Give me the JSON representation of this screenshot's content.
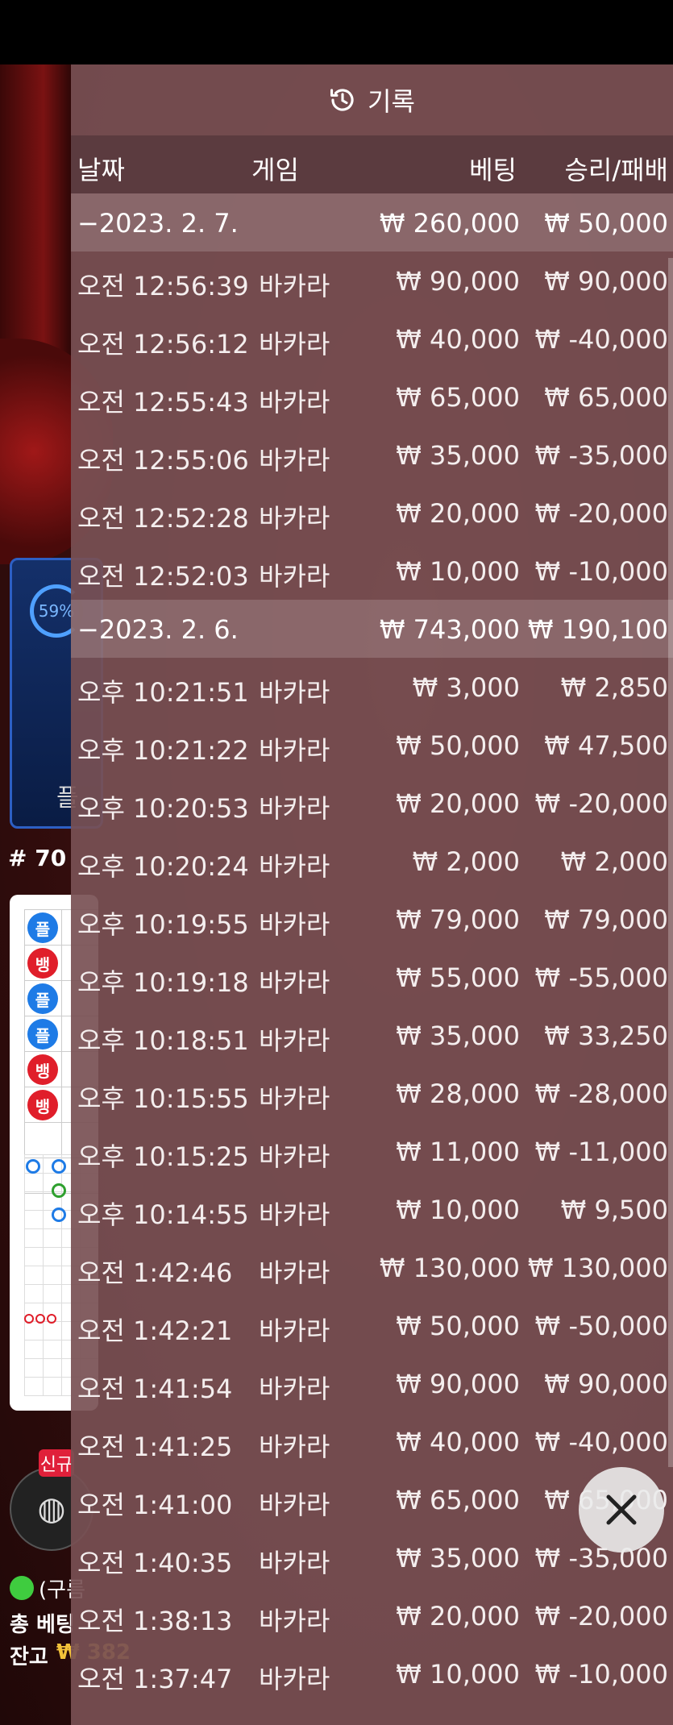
{
  "background": {
    "stat_percent": "59%",
    "stat_label": "플",
    "round_label": "# 70",
    "beads": [
      {
        "label": "플",
        "type": "player"
      },
      {
        "label": "뱅",
        "type": "banker"
      },
      {
        "label": "플",
        "type": "player"
      },
      {
        "label": "플",
        "type": "player"
      },
      {
        "label": "뱅",
        "type": "banker"
      },
      {
        "label": "뱅",
        "type": "banker"
      }
    ],
    "new_badge": "신규",
    "status_text": "(구름",
    "total_bet_label": "총 베팅",
    "balance_label": "잔고",
    "balance_value": "₩ 382"
  },
  "panel": {
    "title": "기록",
    "columns": {
      "date": "날짜",
      "game": "게임",
      "bet": "베팅",
      "result": "승리/패배"
    },
    "groups": [
      {
        "date": "−2023. 2. 7.",
        "bet_total": "₩ 260,000",
        "result_total": "₩ 50,000",
        "rows": [
          {
            "time": "오전 12:56:39",
            "game": "바카라",
            "bet": "₩ 90,000",
            "result": "₩ 90,000"
          },
          {
            "time": "오전 12:56:12",
            "game": "바카라",
            "bet": "₩ 40,000",
            "result": "₩ -40,000"
          },
          {
            "time": "오전 12:55:43",
            "game": "바카라",
            "bet": "₩ 65,000",
            "result": "₩ 65,000"
          },
          {
            "time": "오전 12:55:06",
            "game": "바카라",
            "bet": "₩ 35,000",
            "result": "₩ -35,000"
          },
          {
            "time": "오전 12:52:28",
            "game": "바카라",
            "bet": "₩ 20,000",
            "result": "₩ -20,000"
          },
          {
            "time": "오전 12:52:03",
            "game": "바카라",
            "bet": "₩ 10,000",
            "result": "₩ -10,000"
          }
        ]
      },
      {
        "date": "−2023. 2. 6.",
        "bet_total": "₩ 743,000",
        "result_total": "₩ 190,100",
        "rows": [
          {
            "time": "오후 10:21:51",
            "game": "바카라",
            "bet": "₩ 3,000",
            "result": "₩ 2,850"
          },
          {
            "time": "오후 10:21:22",
            "game": "바카라",
            "bet": "₩ 50,000",
            "result": "₩ 47,500"
          },
          {
            "time": "오후 10:20:53",
            "game": "바카라",
            "bet": "₩ 20,000",
            "result": "₩ -20,000"
          },
          {
            "time": "오후 10:20:24",
            "game": "바카라",
            "bet": "₩ 2,000",
            "result": "₩ 2,000"
          },
          {
            "time": "오후 10:19:55",
            "game": "바카라",
            "bet": "₩ 79,000",
            "result": "₩ 79,000"
          },
          {
            "time": "오후 10:19:18",
            "game": "바카라",
            "bet": "₩ 55,000",
            "result": "₩ -55,000"
          },
          {
            "time": "오후 10:18:51",
            "game": "바카라",
            "bet": "₩ 35,000",
            "result": "₩ 33,250"
          },
          {
            "time": "오후 10:15:55",
            "game": "바카라",
            "bet": "₩ 28,000",
            "result": "₩ -28,000"
          },
          {
            "time": "오후 10:15:25",
            "game": "바카라",
            "bet": "₩ 11,000",
            "result": "₩ -11,000"
          },
          {
            "time": "오후 10:14:55",
            "game": "바카라",
            "bet": "₩ 10,000",
            "result": "₩ 9,500"
          },
          {
            "time": "오전 1:42:46",
            "game": "바카라",
            "bet": "₩ 130,000",
            "result": "₩ 130,000"
          },
          {
            "time": "오전 1:42:21",
            "game": "바카라",
            "bet": "₩ 50,000",
            "result": "₩ -50,000"
          },
          {
            "time": "오전 1:41:54",
            "game": "바카라",
            "bet": "₩ 90,000",
            "result": "₩ 90,000"
          },
          {
            "time": "오전 1:41:25",
            "game": "바카라",
            "bet": "₩ 40,000",
            "result": "₩ -40,000"
          },
          {
            "time": "오전 1:41:00",
            "game": "바카라",
            "bet": "₩ 65,000",
            "result": "₩ 65,000"
          },
          {
            "time": "오전 1:40:35",
            "game": "바카라",
            "bet": "₩ 35,000",
            "result": "₩ -35,000"
          },
          {
            "time": "오전 1:38:13",
            "game": "바카라",
            "bet": "₩ 20,000",
            "result": "₩ -20,000"
          },
          {
            "time": "오전 1:37:47",
            "game": "바카라",
            "bet": "₩ 10,000",
            "result": "₩ -10,000"
          }
        ]
      }
    ]
  },
  "icons": {
    "history": "history-clock-icon",
    "close": "close-icon"
  }
}
